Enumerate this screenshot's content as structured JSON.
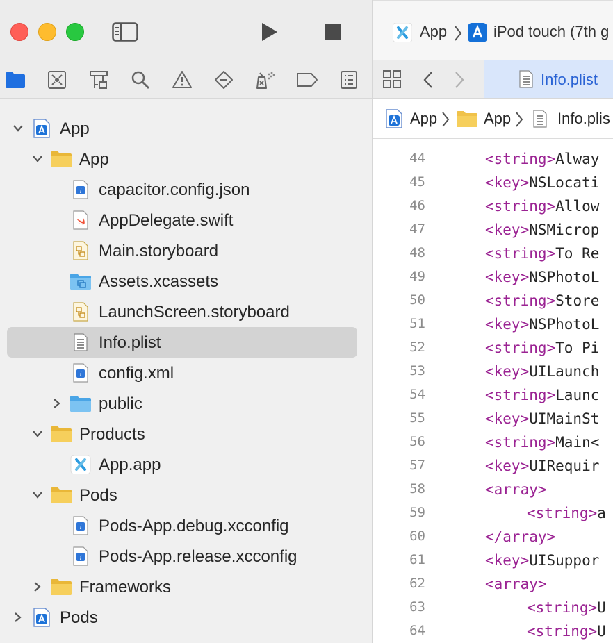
{
  "titlebar": {
    "scheme": "App",
    "destination": "iPod touch (7th g"
  },
  "colors": {
    "accent": "#2a63d4",
    "folder": "#f0c24a",
    "tag": "#9b2393",
    "selected_row": "#d3d3d3"
  },
  "navigator_tabs": [
    {
      "name": "project-navigator-icon",
      "active": true
    },
    {
      "name": "source-control-navigator-icon"
    },
    {
      "name": "symbol-navigator-icon"
    },
    {
      "name": "find-navigator-icon"
    },
    {
      "name": "issue-navigator-icon"
    },
    {
      "name": "test-navigator-icon"
    },
    {
      "name": "debug-navigator-icon"
    },
    {
      "name": "breakpoint-navigator-icon"
    },
    {
      "name": "report-navigator-icon"
    }
  ],
  "tree": [
    {
      "label": "App",
      "indent": 0,
      "icon": "project",
      "disclosure": "open"
    },
    {
      "label": "App",
      "indent": 1,
      "icon": "folder",
      "disclosure": "open"
    },
    {
      "label": "capacitor.config.json",
      "indent": 2,
      "icon": "json-file"
    },
    {
      "label": "AppDelegate.swift",
      "indent": 2,
      "icon": "swift-file"
    },
    {
      "label": "Main.storyboard",
      "indent": 2,
      "icon": "storyboard-file"
    },
    {
      "label": "Assets.xcassets",
      "indent": 2,
      "icon": "assets-folder"
    },
    {
      "label": "LaunchScreen.storyboard",
      "indent": 2,
      "icon": "storyboard-file"
    },
    {
      "label": "Info.plist",
      "indent": 2,
      "icon": "plist-file",
      "selected": true
    },
    {
      "label": "config.xml",
      "indent": 2,
      "icon": "xml-file"
    },
    {
      "label": "public",
      "indent": 2,
      "icon": "blue-folder",
      "disclosure": "closed"
    },
    {
      "label": "Products",
      "indent": 1,
      "icon": "folder",
      "disclosure": "open"
    },
    {
      "label": "App.app",
      "indent": 2,
      "icon": "app-product"
    },
    {
      "label": "Pods",
      "indent": 1,
      "icon": "folder",
      "disclosure": "open"
    },
    {
      "label": "Pods-App.debug.xcconfig",
      "indent": 2,
      "icon": "xcconfig-file"
    },
    {
      "label": "Pods-App.release.xcconfig",
      "indent": 2,
      "icon": "xcconfig-file"
    },
    {
      "label": "Frameworks",
      "indent": 1,
      "icon": "folder",
      "disclosure": "closed"
    },
    {
      "label": "Pods",
      "indent": 0,
      "icon": "project",
      "disclosure": "closed"
    }
  ],
  "tab": {
    "label": "Info.plist"
  },
  "jumpbar": {
    "project": "App",
    "group": "App",
    "file": "Info.plis"
  },
  "code": [
    {
      "n": "44",
      "indent": 0,
      "tag": "<string>",
      "text": "Alway"
    },
    {
      "n": "45",
      "indent": 0,
      "tag": "<key>",
      "text": "NSLocati"
    },
    {
      "n": "46",
      "indent": 0,
      "tag": "<string>",
      "text": "Allow"
    },
    {
      "n": "47",
      "indent": 0,
      "tag": "<key>",
      "text": "NSMicrop"
    },
    {
      "n": "48",
      "indent": 0,
      "tag": "<string>",
      "text": "To Re"
    },
    {
      "n": "49",
      "indent": 0,
      "tag": "<key>",
      "text": "NSPhotoL"
    },
    {
      "n": "50",
      "indent": 0,
      "tag": "<string>",
      "text": "Store"
    },
    {
      "n": "51",
      "indent": 0,
      "tag": "<key>",
      "text": "NSPhotoL"
    },
    {
      "n": "52",
      "indent": 0,
      "tag": "<string>",
      "text": "To Pi"
    },
    {
      "n": "53",
      "indent": 0,
      "tag": "<key>",
      "text": "UILaunch"
    },
    {
      "n": "54",
      "indent": 0,
      "tag": "<string>",
      "text": "Launc"
    },
    {
      "n": "55",
      "indent": 0,
      "tag": "<key>",
      "text": "UIMainSt"
    },
    {
      "n": "56",
      "indent": 0,
      "tag": "<string>",
      "text": "Main<"
    },
    {
      "n": "57",
      "indent": 0,
      "tag": "<key>",
      "text": "UIRequir"
    },
    {
      "n": "58",
      "indent": 0,
      "tag": "<array>",
      "text": ""
    },
    {
      "n": "59",
      "indent": 1,
      "tag": "<string>",
      "text": "a"
    },
    {
      "n": "60",
      "indent": 0,
      "tag": "</array>",
      "text": ""
    },
    {
      "n": "61",
      "indent": 0,
      "tag": "<key>",
      "text": "UISuppor"
    },
    {
      "n": "62",
      "indent": 0,
      "tag": "<array>",
      "text": ""
    },
    {
      "n": "63",
      "indent": 1,
      "tag": "<string>",
      "text": "U"
    },
    {
      "n": "64",
      "indent": 1,
      "tag": "<string>",
      "text": "U"
    }
  ]
}
